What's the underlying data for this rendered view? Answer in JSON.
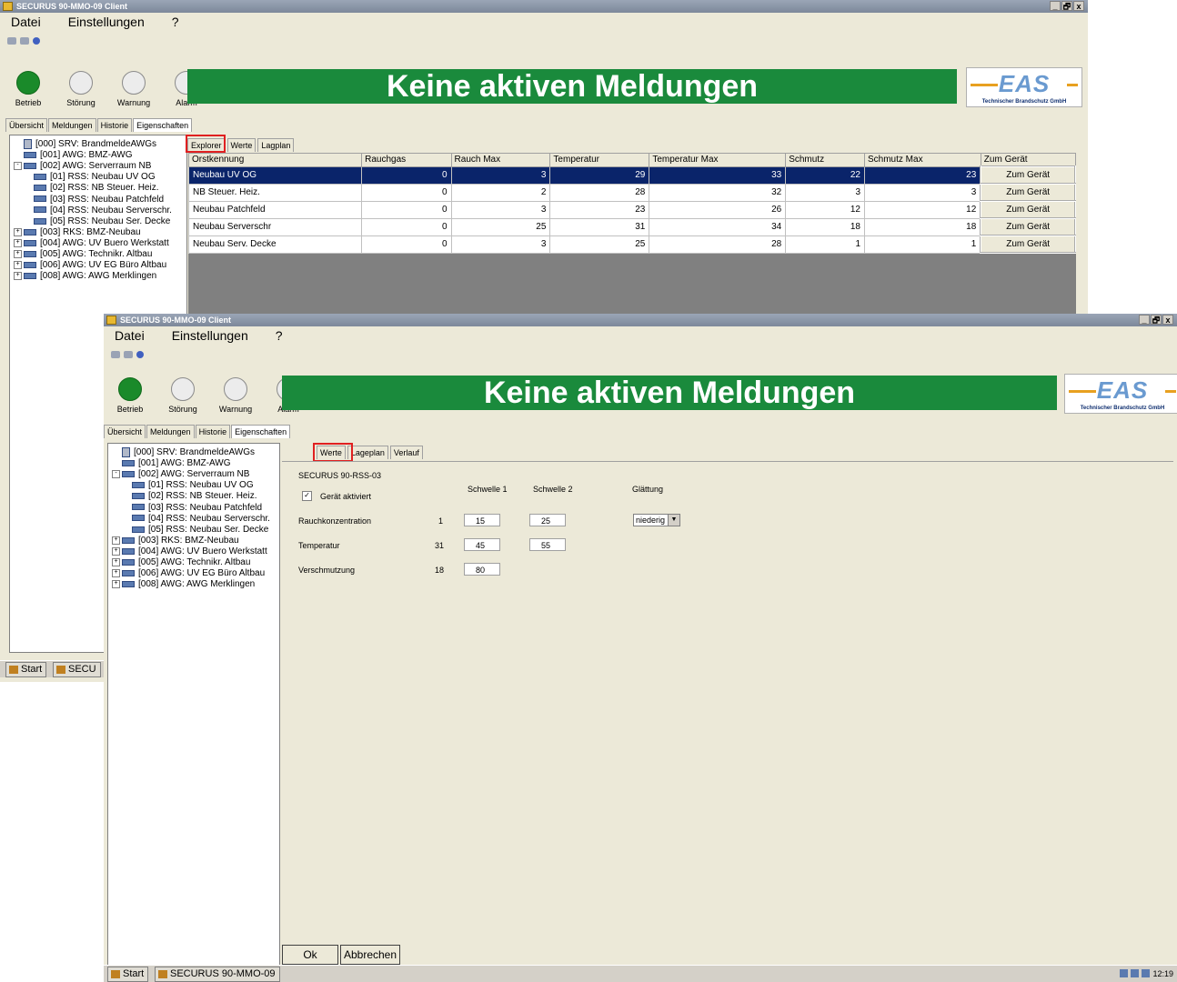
{
  "app": {
    "title": "SECURUS 90-MMO-09 Client",
    "menu": [
      "Datei",
      "Einstellungen",
      "?"
    ],
    "controls": [
      "_",
      "🗗",
      "x"
    ]
  },
  "status_lamps": [
    {
      "label": "Betrieb",
      "active": true
    },
    {
      "label": "Störung",
      "active": false
    },
    {
      "label": "Warnung",
      "active": false
    },
    {
      "label": "Alarm",
      "active": false
    }
  ],
  "banner": {
    "text": "Keine aktiven Meldungen",
    "color": "#1a8a3c"
  },
  "logo": {
    "letters": "EAS",
    "subtitle": "Technischer Brandschutz GmbH"
  },
  "top_tabs": [
    "Übersicht",
    "Meldungen",
    "Historie",
    "Eigenschaften"
  ],
  "tree": [
    {
      "label": "[000] SRV: BrandmeldeAWGs",
      "level": 0,
      "icon": "server-icon"
    },
    {
      "label": "[001] AWG: BMZ-AWG",
      "level": 0,
      "icon": "device-icon"
    },
    {
      "label": "[002] AWG: Serverraum NB",
      "level": 0,
      "icon": "device-icon",
      "expand": "-"
    },
    {
      "label": "[01] RSS: Neubau UV OG",
      "level": 1,
      "icon": "sensor-icon"
    },
    {
      "label": "[02] RSS: NB Steuer. Heiz.",
      "level": 1,
      "icon": "sensor-icon"
    },
    {
      "label": "[03] RSS: Neubau Patchfeld",
      "level": 1,
      "icon": "sensor-icon"
    },
    {
      "label": "[04] RSS: Neubau Serverschr.",
      "level": 1,
      "icon": "sensor-icon"
    },
    {
      "label": "[05] RSS: Neubau Ser. Decke",
      "level": 1,
      "icon": "sensor-icon"
    },
    {
      "label": "[003] RKS: BMZ-Neubau",
      "level": 0,
      "icon": "device-icon",
      "expand": "+"
    },
    {
      "label": "[004] AWG: UV Buero Werkstatt",
      "level": 0,
      "icon": "device-icon",
      "expand": "+"
    },
    {
      "label": "[005] AWG: Technikr. Altbau",
      "level": 0,
      "icon": "device-icon",
      "expand": "+"
    },
    {
      "label": "[006] AWG: UV EG Büro Altbau",
      "level": 0,
      "icon": "device-icon",
      "expand": "+"
    },
    {
      "label": "[008] AWG: AWG Merklingen",
      "level": 0,
      "icon": "device-icon",
      "expand": "+"
    }
  ],
  "window1": {
    "subtabs": [
      "Explorer",
      "Werte",
      "Lagplan"
    ],
    "table": {
      "headers": [
        "Orstkennung",
        "Rauchgas",
        "Rauch Max",
        "Temperatur",
        "Temperatur Max",
        "Schmutz",
        "Schmutz Max",
        "Zum Gerät"
      ],
      "rows": [
        [
          "Neubau UV OG",
          "0",
          "3",
          "29",
          "33",
          "22",
          "23",
          "Zum Gerät"
        ],
        [
          "NB Steuer. Heiz.",
          "0",
          "2",
          "28",
          "32",
          "3",
          "3",
          "Zum Gerät"
        ],
        [
          "Neubau Patchfeld",
          "0",
          "3",
          "23",
          "26",
          "12",
          "12",
          "Zum Gerät"
        ],
        [
          "Neubau Serverschr",
          "0",
          "25",
          "31",
          "34",
          "18",
          "18",
          "Zum Gerät"
        ],
        [
          "Neubau Serv. Decke",
          "0",
          "3",
          "25",
          "28",
          "1",
          "1",
          "Zum Gerät"
        ]
      ]
    },
    "taskbar": {
      "start": "Start",
      "app": "SECU"
    }
  },
  "window2": {
    "subtabs": [
      "Werte",
      "Lageplan",
      "Verlauf"
    ],
    "form": {
      "device": "SECURUS 90-RSS-03",
      "enabled_label": "Gerät aktiviert",
      "enabled": "✓",
      "col_threshold1": "Schwelle 1",
      "col_threshold2": "Schwelle 2",
      "col_smoothing": "Glättung",
      "rows": [
        {
          "label": "Rauchkonzentration",
          "value": "1",
          "t1": "15",
          "t2": "25"
        },
        {
          "label": "Temperatur",
          "value": "31",
          "t1": "45",
          "t2": "55"
        },
        {
          "label": "Verschmutzung",
          "value": "18",
          "t1": "80"
        }
      ],
      "smoothing": "niederig"
    },
    "buttons": {
      "ok": "Ok",
      "cancel": "Abbrechen"
    },
    "taskbar": {
      "start": "Start",
      "app": "SECURUS 90-MMO-09",
      "clock": "12:19"
    }
  }
}
